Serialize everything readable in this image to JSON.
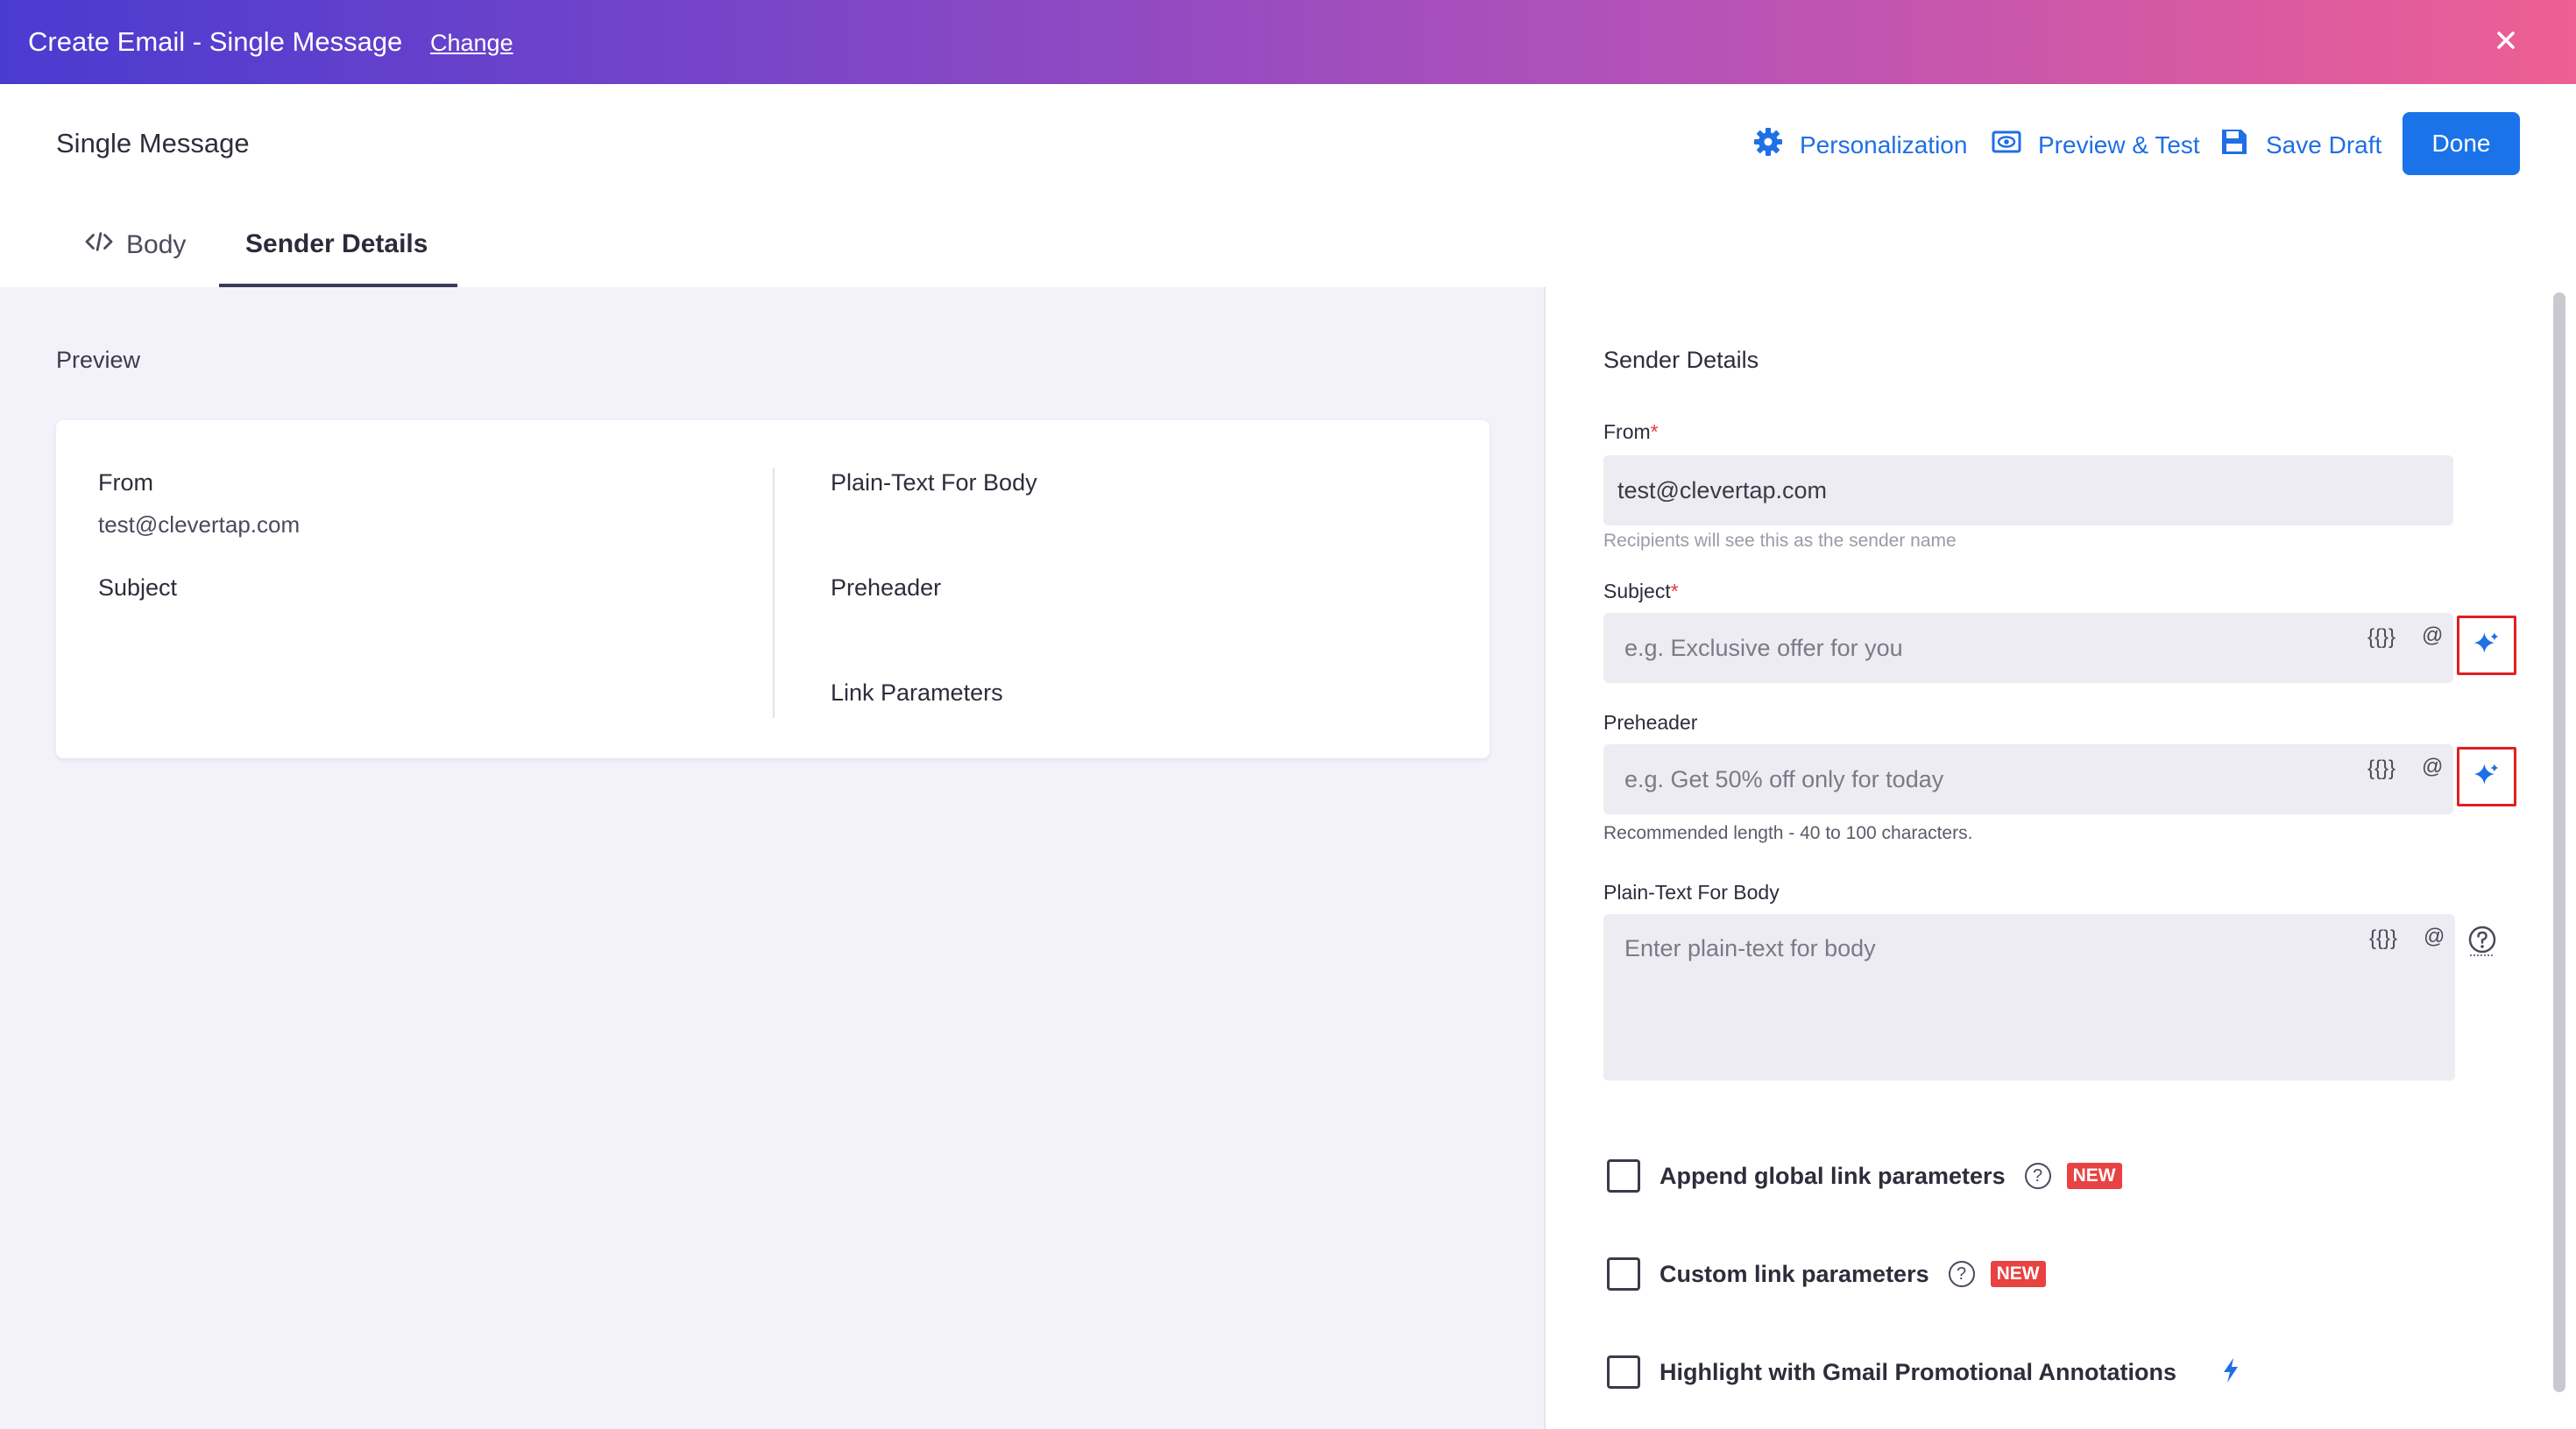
{
  "topbar": {
    "title": "Create Email - Single Message",
    "change_label": "Change"
  },
  "header": {
    "title": "Single Message",
    "personalization_label": "Personalization",
    "preview_label": "Preview & Test",
    "save_label": "Save Draft",
    "done_label": "Done"
  },
  "tabs": [
    {
      "label": "Body",
      "icon": "code-icon",
      "active": false
    },
    {
      "label": "Sender Details",
      "active": true
    }
  ],
  "preview": {
    "section_label": "Preview",
    "from_label": "From",
    "from_value": "test@clevertap.com",
    "subject_label": "Subject",
    "plaintext_label": "Plain-Text For Body",
    "preheader_label": "Preheader",
    "link_params_label": "Link Parameters"
  },
  "sender": {
    "title": "Sender Details",
    "from_label": "From",
    "from_value": "test@clevertap.com",
    "from_hint": "Recipients will see this as the sender name",
    "subject_label": "Subject",
    "subject_placeholder": "e.g. Exclusive offer for you",
    "preheader_label": "Preheader",
    "preheader_placeholder": "e.g. Get 50% off only for today",
    "preheader_hint": "Recommended length - 40 to 100 characters.",
    "plaintext_label": "Plain-Text For Body",
    "plaintext_placeholder": "Enter plain-text for body",
    "token_braces": "{{}}",
    "token_at": "@",
    "required_mark": "*"
  },
  "checkboxes": [
    {
      "label": "Append global link parameters",
      "badge": "NEW",
      "help": true
    },
    {
      "label": "Custom link parameters",
      "badge": "NEW",
      "help": true
    },
    {
      "label": "Highlight with Gmail Promotional Annotations",
      "icon": "lightning-icon"
    }
  ],
  "help_glyph": "?",
  "colors": {
    "accent": "#1a73e8",
    "badge": "#e84242",
    "ai_highlight": "#e02020",
    "gradient_start": "#4a3bd0",
    "gradient_end": "#ee5f94"
  }
}
